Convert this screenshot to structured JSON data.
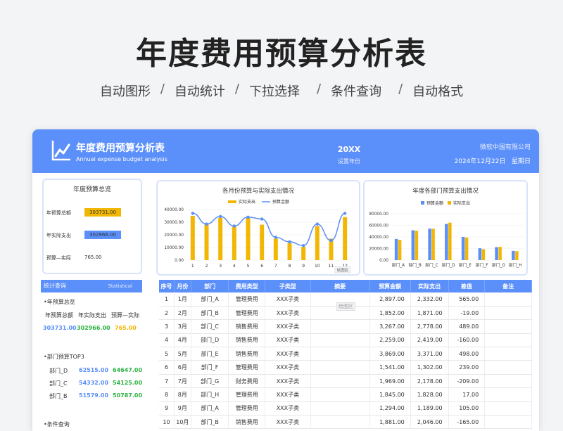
{
  "hero": {
    "title": "年度费用预算分析表",
    "features": [
      "自动图形",
      "自动统计",
      "下拉选择",
      "条件查询",
      "自动格式"
    ]
  },
  "banner": {
    "title": "年度费用预算分析表",
    "subtitle": "Annual expense budget analysis",
    "year": "20XX",
    "year_label": "设置年份",
    "company": "微软中国有限公司",
    "date": "2024年12月22日",
    "weekday": "星期日"
  },
  "overview": {
    "title": "年度预算总览",
    "budget_label": "年预算总额",
    "budget_value": "303731.00",
    "actual_label": "年实际支出",
    "actual_value": "302966.00",
    "diff_label": "预算—实际",
    "diff_value": "765.00",
    "budget_color": "#f2b705",
    "actual_color": "#5b8ff9"
  },
  "stats": {
    "title": "统计查询",
    "title_en": "Statistical",
    "summary_title": "•年预算总览",
    "col1": "年预算总额",
    "col2": "年实际支出",
    "col3": "预算—实际",
    "val1": "303731.00",
    "val2": "302966.00",
    "val3": "765.00",
    "top_title": "•部门预算TOP3",
    "top": [
      {
        "dept": "部门_D",
        "budget": "62515.00",
        "actual": "64647.00"
      },
      {
        "dept": "部门_C",
        "budget": "54332.00",
        "actual": "54125.00"
      },
      {
        "dept": "部门_B",
        "budget": "51579.00",
        "actual": "50787.00"
      }
    ],
    "cond_title": "•条件查询"
  },
  "chart_data": [
    {
      "type": "bar",
      "title": "各月份预算与实际支出情况",
      "categories": [
        "1",
        "2",
        "3",
        "4",
        "5",
        "6",
        "7",
        "8",
        "9",
        "10",
        "11",
        "12"
      ],
      "series": [
        {
          "name": "实际支出",
          "type": "bar",
          "values": [
            35000,
            28500,
            33500,
            26500,
            33500,
            28000,
            17000,
            13500,
            10500,
            27000,
            17000,
            34000
          ]
        },
        {
          "name": "预算金额",
          "type": "line",
          "values": [
            37000,
            28500,
            34500,
            27000,
            34000,
            32500,
            18000,
            14500,
            11500,
            28500,
            15500,
            37000
          ]
        }
      ],
      "ylim": [
        0,
        40000
      ],
      "yticks": [
        "0.00",
        "10000.00",
        "20000.00",
        "30000.00",
        "40000.00"
      ],
      "colors": {
        "bar": "#f2b705",
        "line": "#5b8ff9"
      },
      "legend": "top",
      "tooltip": "绘图区"
    },
    {
      "type": "bar",
      "title": "年度各部门预算支出情况",
      "categories": [
        "部门_A",
        "部门_B",
        "部门_C",
        "部门_D",
        "部门_E",
        "部门_F",
        "部门_G",
        "部门_H"
      ],
      "series": [
        {
          "name": "预算金额",
          "values": [
            36500,
            51500,
            54332,
            62515,
            40000,
            20500,
            22500,
            16000
          ]
        },
        {
          "name": "实际支出",
          "values": [
            35000,
            50787,
            54125,
            64647,
            39000,
            19000,
            23000,
            15500
          ]
        }
      ],
      "ylim": [
        0,
        80000
      ],
      "yticks": [
        "0.00",
        "20000.00",
        "40000.00",
        "60000.00",
        "80000.00"
      ],
      "colors": [
        "#5b8ff9",
        "#f2b705"
      ],
      "legend": "top"
    }
  ],
  "table": {
    "headers": [
      "序号",
      "月份",
      "部门",
      "费用类型",
      "子类型",
      "摘要",
      "预算金额",
      "实际支出",
      "差值",
      "备注"
    ],
    "note": "绘图区",
    "rows": [
      [
        "1",
        "1月",
        "部门_A",
        "管理费用",
        "XXX子类",
        "",
        "2,897.00",
        "2,332.00",
        "565.00",
        ""
      ],
      [
        "2",
        "2月",
        "部门_B",
        "管理费用",
        "XXX子类",
        "",
        "1,852.00",
        "1,871.00",
        "-19.00",
        ""
      ],
      [
        "3",
        "3月",
        "部门_C",
        "销售费用",
        "XXX子类",
        "",
        "3,267.00",
        "2,778.00",
        "489.00",
        ""
      ],
      [
        "4",
        "4月",
        "部门_D",
        "销售费用",
        "XXX子类",
        "",
        "2,259.00",
        "2,419.00",
        "-160.00",
        ""
      ],
      [
        "5",
        "5月",
        "部门_E",
        "销售费用",
        "XXX子类",
        "",
        "3,869.00",
        "3,371.00",
        "498.00",
        ""
      ],
      [
        "6",
        "6月",
        "部门_F",
        "管理费用",
        "XXX子类",
        "",
        "1,541.00",
        "1,302.00",
        "239.00",
        ""
      ],
      [
        "7",
        "7月",
        "部门_G",
        "财务费用",
        "XXX子类",
        "",
        "1,969.00",
        "2,178.00",
        "-209.00",
        ""
      ],
      [
        "8",
        "8月",
        "部门_H",
        "管理费用",
        "XXX子类",
        "",
        "1,845.00",
        "1,828.00",
        "17.00",
        ""
      ],
      [
        "9",
        "9月",
        "部门_A",
        "管理费用",
        "XXX子类",
        "",
        "1,294.00",
        "1,189.00",
        "105.00",
        ""
      ],
      [
        "10",
        "10月",
        "部门_B",
        "销售费用",
        "XXX子类",
        "",
        "1,881.00",
        "2,046.00",
        "-165.00",
        ""
      ]
    ]
  }
}
